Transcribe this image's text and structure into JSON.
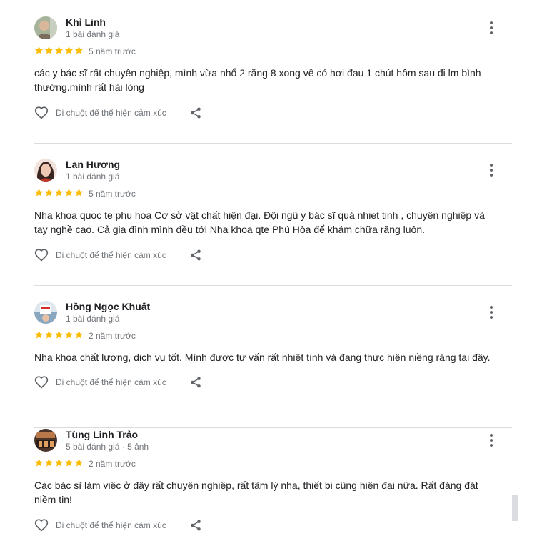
{
  "reviews": [
    {
      "name": "Khỉ Linh",
      "meta": "1 bài đánh giá",
      "rating": 5,
      "time": "5 năm trước",
      "text": "các y bác sĩ rất chuyên nghiệp, mình vừa nhổ 2 răng 8 xong về có hơi đau 1 chút hôm sau đi lm bình thường.mình rất hài lòng",
      "like_label": "Di chuột để thể hiện cảm xúc",
      "avatar_color": "#8a9a7a"
    },
    {
      "name": "Lan Hương",
      "meta": "1 bài đánh giá",
      "rating": 5,
      "time": "5 năm trước",
      "text": "Nha khoa quoc te phu hoa Cơ sở vật chất hiện đại. Đội ngũ y bác sĩ quá nhiet tinh , chuyên nghiệp và tay nghề cao. Cả gia đình mình đều tới Nha khoa qte Phú Hòa để khám chữa răng luôn.",
      "like_label": "Di chuột để thể hiện cảm xúc",
      "avatar_color": "#c98f7a"
    },
    {
      "name": "Hồng Ngọc Khuất",
      "meta": "1 bài đánh giá",
      "rating": 5,
      "time": "2 năm trước",
      "text": "Nha khoa chất lượng, dịch vụ tốt. Mình được tư vấn rất nhiệt tình và đang thực hiện niềng răng tại đây.",
      "like_label": "Di chuột để thể hiện cảm xúc",
      "avatar_color": "#9fb3c4"
    },
    {
      "name": "Tùng Linh Trảo",
      "meta": "5 bài đánh giá · 5 ảnh",
      "rating": 5,
      "time": "2 năm trước",
      "text": "Các bác sĩ làm việc ở đây rất chuyên nghiệp, rất tâm lý nha, thiết bị cũng hiện đại nữa. Rất đáng đặt niềm tin!",
      "like_label": "Di chuột để thể hiện cảm xúc",
      "avatar_color": "#6b4a3a"
    }
  ],
  "colors": {
    "star": "#fbbc04",
    "icon": "#5f6368",
    "divider": "#dadce0"
  }
}
